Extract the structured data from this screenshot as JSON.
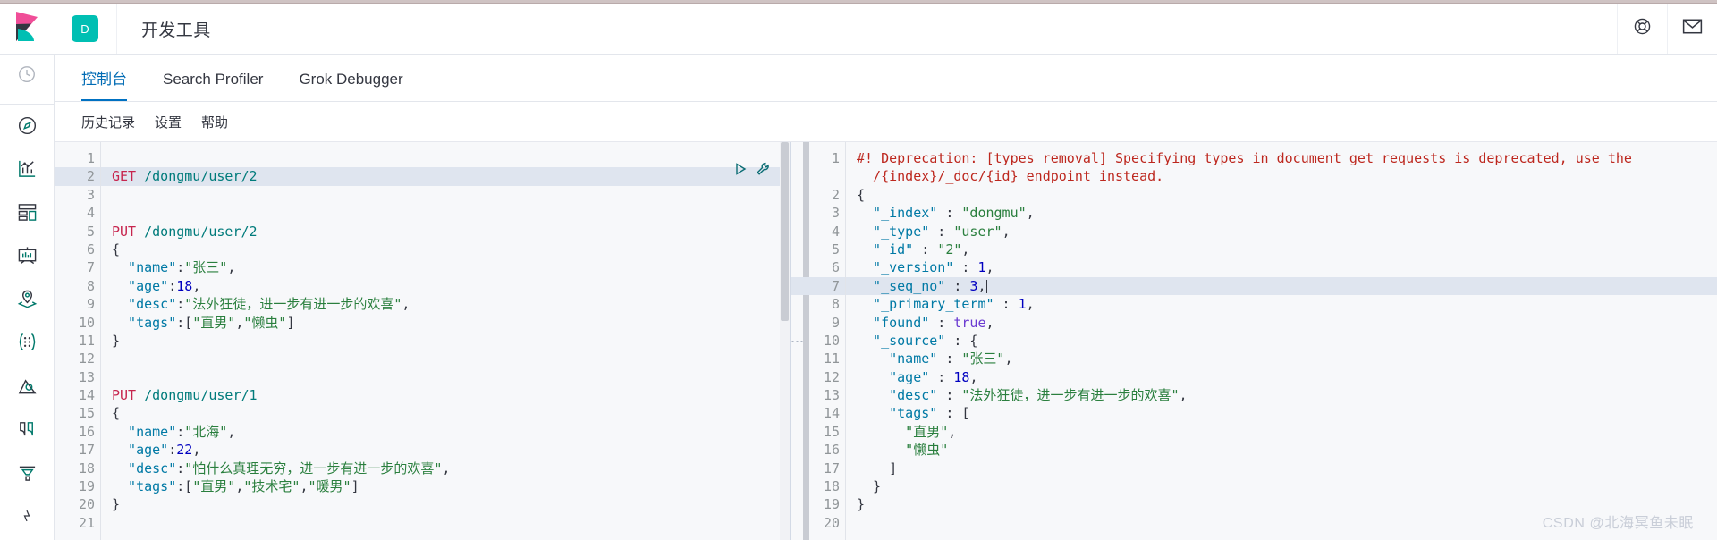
{
  "header": {
    "logo_name": "kibana-logo",
    "space_initial": "D",
    "app_title": "开发工具",
    "help_icon": "lifebuoy-help-icon",
    "mail_icon": "envelope-mail-icon"
  },
  "rail": {
    "items": [
      {
        "icon": "recently-viewed-clock-icon",
        "name": "recently-viewed"
      },
      {
        "icon": "compass-discover-icon",
        "name": "discover"
      },
      {
        "icon": "visualize-chart-icon",
        "name": "visualize"
      },
      {
        "icon": "dashboard-grid-icon",
        "name": "dashboard"
      },
      {
        "icon": "canvas-presentation-icon",
        "name": "canvas"
      },
      {
        "icon": "maps-layers-icon",
        "name": "maps"
      },
      {
        "icon": "machine-learning-nodes-icon",
        "name": "machine-learning"
      },
      {
        "icon": "infrastructure-icon",
        "name": "infrastructure"
      },
      {
        "icon": "logs-stream-icon",
        "name": "logs"
      },
      {
        "icon": "apm-icon",
        "name": "apm"
      },
      {
        "icon": "uptime-icon",
        "name": "uptime"
      }
    ]
  },
  "tabs": [
    {
      "label": "控制台",
      "active": true
    },
    {
      "label": "Search Profiler",
      "active": false
    },
    {
      "label": "Grok Debugger",
      "active": false
    }
  ],
  "menu": [
    {
      "label": "历史记录"
    },
    {
      "label": "设置"
    },
    {
      "label": "帮助"
    }
  ],
  "editor": {
    "play_icon": "play-send-request-icon",
    "wrench_icon": "wrench-options-icon",
    "splitter_icon": "drag-handle-dots-icon",
    "request": {
      "highlight_line": 2,
      "lines": [
        {
          "n": 1,
          "fold": "",
          "tokens": []
        },
        {
          "n": 2,
          "fold": "",
          "tokens": [
            {
              "c": "t-method",
              "t": "GET"
            },
            {
              "c": "t-punct",
              "t": " "
            },
            {
              "c": "t-url",
              "t": "/dongmu/user/2"
            }
          ]
        },
        {
          "n": 3,
          "fold": "",
          "tokens": []
        },
        {
          "n": 4,
          "fold": "",
          "tokens": []
        },
        {
          "n": 5,
          "fold": "",
          "tokens": [
            {
              "c": "t-method",
              "t": "PUT"
            },
            {
              "c": "t-punct",
              "t": " "
            },
            {
              "c": "t-url",
              "t": "/dongmu/user/2"
            }
          ]
        },
        {
          "n": 6,
          "fold": "▾",
          "tokens": [
            {
              "c": "t-punct",
              "t": "{"
            }
          ]
        },
        {
          "n": 7,
          "fold": "",
          "tokens": [
            {
              "c": "t-key",
              "t": "  \"name\""
            },
            {
              "c": "t-punct",
              "t": ":"
            },
            {
              "c": "t-str",
              "t": "\"张三\""
            },
            {
              "c": "t-punct",
              "t": ","
            }
          ]
        },
        {
          "n": 8,
          "fold": "",
          "tokens": [
            {
              "c": "t-key",
              "t": "  \"age\""
            },
            {
              "c": "t-punct",
              "t": ":"
            },
            {
              "c": "t-num",
              "t": "18"
            },
            {
              "c": "t-punct",
              "t": ","
            }
          ]
        },
        {
          "n": 9,
          "fold": "",
          "tokens": [
            {
              "c": "t-key",
              "t": "  \"desc\""
            },
            {
              "c": "t-punct",
              "t": ":"
            },
            {
              "c": "t-str",
              "t": "\"法外狂徒，进一步有进一步的欢喜\""
            },
            {
              "c": "t-punct",
              "t": ","
            }
          ]
        },
        {
          "n": 10,
          "fold": "",
          "tokens": [
            {
              "c": "t-key",
              "t": "  \"tags\""
            },
            {
              "c": "t-punct",
              "t": ":["
            },
            {
              "c": "t-str",
              "t": "\"直男\""
            },
            {
              "c": "t-punct",
              "t": ","
            },
            {
              "c": "t-str",
              "t": "\"懒虫\""
            },
            {
              "c": "t-punct",
              "t": "]"
            }
          ]
        },
        {
          "n": 11,
          "fold": "▴",
          "tokens": [
            {
              "c": "t-punct",
              "t": "}"
            }
          ]
        },
        {
          "n": 12,
          "fold": "",
          "tokens": []
        },
        {
          "n": 13,
          "fold": "",
          "tokens": []
        },
        {
          "n": 14,
          "fold": "",
          "tokens": [
            {
              "c": "t-method",
              "t": "PUT"
            },
            {
              "c": "t-punct",
              "t": " "
            },
            {
              "c": "t-url",
              "t": "/dongmu/user/1"
            }
          ]
        },
        {
          "n": 15,
          "fold": "▾",
          "tokens": [
            {
              "c": "t-punct",
              "t": "{"
            }
          ]
        },
        {
          "n": 16,
          "fold": "",
          "tokens": [
            {
              "c": "t-key",
              "t": "  \"name\""
            },
            {
              "c": "t-punct",
              "t": ":"
            },
            {
              "c": "t-str",
              "t": "\"北海\""
            },
            {
              "c": "t-punct",
              "t": ","
            }
          ]
        },
        {
          "n": 17,
          "fold": "",
          "tokens": [
            {
              "c": "t-key",
              "t": "  \"age\""
            },
            {
              "c": "t-punct",
              "t": ":"
            },
            {
              "c": "t-num",
              "t": "22"
            },
            {
              "c": "t-punct",
              "t": ","
            }
          ]
        },
        {
          "n": 18,
          "fold": "",
          "tokens": [
            {
              "c": "t-key",
              "t": "  \"desc\""
            },
            {
              "c": "t-punct",
              "t": ":"
            },
            {
              "c": "t-str",
              "t": "\"怕什么真理无穷，进一步有进一步的欢喜\""
            },
            {
              "c": "t-punct",
              "t": ","
            }
          ]
        },
        {
          "n": 19,
          "fold": "",
          "tokens": [
            {
              "c": "t-key",
              "t": "  \"tags\""
            },
            {
              "c": "t-punct",
              "t": ":["
            },
            {
              "c": "t-str",
              "t": "\"直男\""
            },
            {
              "c": "t-punct",
              "t": ","
            },
            {
              "c": "t-str",
              "t": "\"技术宅\""
            },
            {
              "c": "t-punct",
              "t": ","
            },
            {
              "c": "t-str",
              "t": "\"暖男\""
            },
            {
              "c": "t-punct",
              "t": "]"
            }
          ]
        },
        {
          "n": 20,
          "fold": "▴",
          "tokens": [
            {
              "c": "t-punct",
              "t": "}"
            }
          ]
        },
        {
          "n": 21,
          "fold": "",
          "tokens": []
        }
      ]
    },
    "response": {
      "highlight_line": 7,
      "lines": [
        {
          "n": 1,
          "fold": "",
          "tokens": [
            {
              "c": "t-warn",
              "t": "#! Deprecation: [types removal] Specifying types in document get requests is deprecated, use the"
            }
          ]
        },
        {
          "n": "",
          "fold": "",
          "tokens": [
            {
              "c": "t-warn",
              "t": "  /{index}/_doc/{id} endpoint instead."
            }
          ]
        },
        {
          "n": 2,
          "fold": "▾",
          "tokens": [
            {
              "c": "t-punct",
              "t": "{"
            }
          ]
        },
        {
          "n": 3,
          "fold": "",
          "tokens": [
            {
              "c": "t-key",
              "t": "  \"_index\""
            },
            {
              "c": "t-punct",
              "t": " : "
            },
            {
              "c": "t-str",
              "t": "\"dongmu\""
            },
            {
              "c": "t-punct",
              "t": ","
            }
          ]
        },
        {
          "n": 4,
          "fold": "",
          "tokens": [
            {
              "c": "t-key",
              "t": "  \"_type\""
            },
            {
              "c": "t-punct",
              "t": " : "
            },
            {
              "c": "t-str",
              "t": "\"user\""
            },
            {
              "c": "t-punct",
              "t": ","
            }
          ]
        },
        {
          "n": 5,
          "fold": "",
          "tokens": [
            {
              "c": "t-key",
              "t": "  \"_id\""
            },
            {
              "c": "t-punct",
              "t": " : "
            },
            {
              "c": "t-str",
              "t": "\"2\""
            },
            {
              "c": "t-punct",
              "t": ","
            }
          ]
        },
        {
          "n": 6,
          "fold": "",
          "tokens": [
            {
              "c": "t-key",
              "t": "  \"_version\""
            },
            {
              "c": "t-punct",
              "t": " : "
            },
            {
              "c": "t-num",
              "t": "1"
            },
            {
              "c": "t-punct",
              "t": ","
            }
          ]
        },
        {
          "n": 7,
          "fold": "",
          "tokens": [
            {
              "c": "t-key",
              "t": "  \"_seq_no\""
            },
            {
              "c": "t-punct",
              "t": " : "
            },
            {
              "c": "t-num",
              "t": "3"
            },
            {
              "c": "t-punct",
              "t": ","
            }
          ],
          "caret": true
        },
        {
          "n": 8,
          "fold": "",
          "tokens": [
            {
              "c": "t-key",
              "t": "  \"_primary_term\""
            },
            {
              "c": "t-punct",
              "t": " : "
            },
            {
              "c": "t-num",
              "t": "1"
            },
            {
              "c": "t-punct",
              "t": ","
            }
          ]
        },
        {
          "n": 9,
          "fold": "",
          "tokens": [
            {
              "c": "t-key",
              "t": "  \"found\""
            },
            {
              "c": "t-punct",
              "t": " : "
            },
            {
              "c": "t-bool",
              "t": "true"
            },
            {
              "c": "t-punct",
              "t": ","
            }
          ]
        },
        {
          "n": 10,
          "fold": "▾",
          "tokens": [
            {
              "c": "t-key",
              "t": "  \"_source\""
            },
            {
              "c": "t-punct",
              "t": " : {"
            }
          ]
        },
        {
          "n": 11,
          "fold": "",
          "tokens": [
            {
              "c": "t-key",
              "t": "    \"name\""
            },
            {
              "c": "t-punct",
              "t": " : "
            },
            {
              "c": "t-str",
              "t": "\"张三\""
            },
            {
              "c": "t-punct",
              "t": ","
            }
          ]
        },
        {
          "n": 12,
          "fold": "",
          "tokens": [
            {
              "c": "t-key",
              "t": "    \"age\""
            },
            {
              "c": "t-punct",
              "t": " : "
            },
            {
              "c": "t-num",
              "t": "18"
            },
            {
              "c": "t-punct",
              "t": ","
            }
          ]
        },
        {
          "n": 13,
          "fold": "",
          "tokens": [
            {
              "c": "t-key",
              "t": "    \"desc\""
            },
            {
              "c": "t-punct",
              "t": " : "
            },
            {
              "c": "t-str",
              "t": "\"法外狂徒，进一步有进一步的欢喜\""
            },
            {
              "c": "t-punct",
              "t": ","
            }
          ]
        },
        {
          "n": 14,
          "fold": "▾",
          "tokens": [
            {
              "c": "t-key",
              "t": "    \"tags\""
            },
            {
              "c": "t-punct",
              "t": " : ["
            }
          ]
        },
        {
          "n": 15,
          "fold": "",
          "tokens": [
            {
              "c": "t-str",
              "t": "      \"直男\""
            },
            {
              "c": "t-punct",
              "t": ","
            }
          ]
        },
        {
          "n": 16,
          "fold": "",
          "tokens": [
            {
              "c": "t-str",
              "t": "      \"懒虫\""
            }
          ]
        },
        {
          "n": 17,
          "fold": "▴",
          "tokens": [
            {
              "c": "t-punct",
              "t": "    ]"
            }
          ]
        },
        {
          "n": 18,
          "fold": "▴",
          "tokens": [
            {
              "c": "t-punct",
              "t": "  }"
            }
          ]
        },
        {
          "n": 19,
          "fold": "▴",
          "tokens": [
            {
              "c": "t-punct",
              "t": "}"
            }
          ]
        },
        {
          "n": 20,
          "fold": "",
          "tokens": []
        }
      ]
    }
  },
  "watermark": "CSDN @北海冥鱼未眠"
}
